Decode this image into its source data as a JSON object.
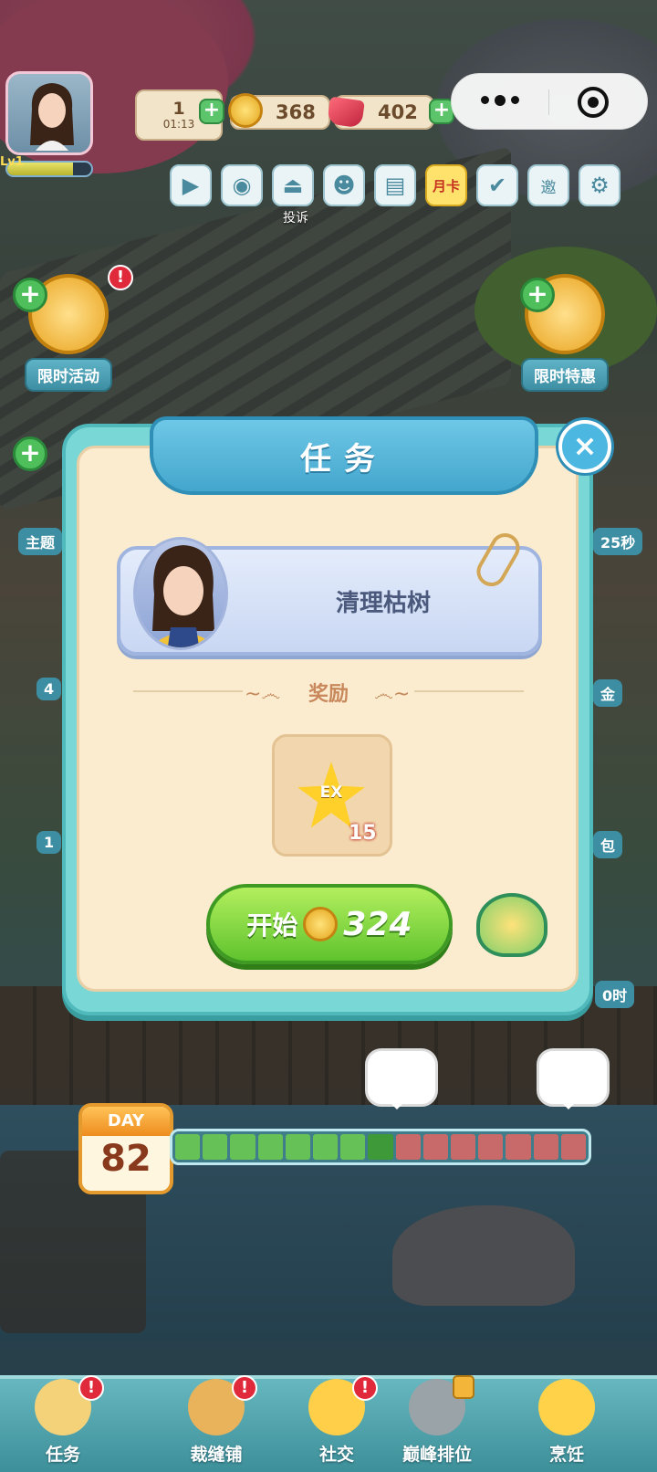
{
  "hud": {
    "energy_value": "1",
    "energy_timer": "01:13",
    "coins": "368",
    "gems": "402",
    "plus_symbol": "+",
    "level_badge": "Lv1"
  },
  "toolbar": {
    "icons": [
      "play-icon",
      "camera-icon",
      "report-icon",
      "friends-icon",
      "book-icon",
      "month-card-icon",
      "checkin-icon",
      "invite-icon",
      "settings-icon"
    ],
    "month_card_label": "月卡",
    "invite_label": "邀",
    "report_caption": "投诉"
  },
  "side_buttons": {
    "left_event": "限时活动",
    "right_deal": "限时特惠",
    "left_theme_partial": "主题",
    "right_timer_partial": "25秒",
    "right_gold_partial": "金",
    "right_pack_partial": "包",
    "right_time_partial": "0时",
    "left_count_partial_1": "4",
    "left_count_partial_2": "1"
  },
  "modal": {
    "title": "任务",
    "close_symbol": "×",
    "task_name": "清理枯树",
    "reward_label": "奖励",
    "reward_item": {
      "icon": "ex-star-icon",
      "label": "EX",
      "quantity": "15"
    },
    "start_button": {
      "label": "开始",
      "cost": "324"
    }
  },
  "day_progress": {
    "day_label": "DAY",
    "day_number": "82",
    "segments_total": 15,
    "segments_done": 8,
    "current_segment": 8
  },
  "bottom_nav": {
    "items": [
      {
        "label": "任务",
        "icon": "task-clipboard-icon",
        "alert": true
      },
      {
        "label": "裁缝铺",
        "icon": "sewing-icon",
        "alert": true
      },
      {
        "label": "社交",
        "icon": "social-icon",
        "alert": true
      },
      {
        "label": "巅峰排位",
        "icon": "ranking-icon",
        "locked": true
      },
      {
        "label": "烹饪",
        "icon": "cooking-icon",
        "alert": false
      }
    ],
    "alert_symbol": "!"
  },
  "miniprogram_capsule": {
    "menu_icon": "more-dots-icon",
    "close_icon": "target-close-icon"
  }
}
